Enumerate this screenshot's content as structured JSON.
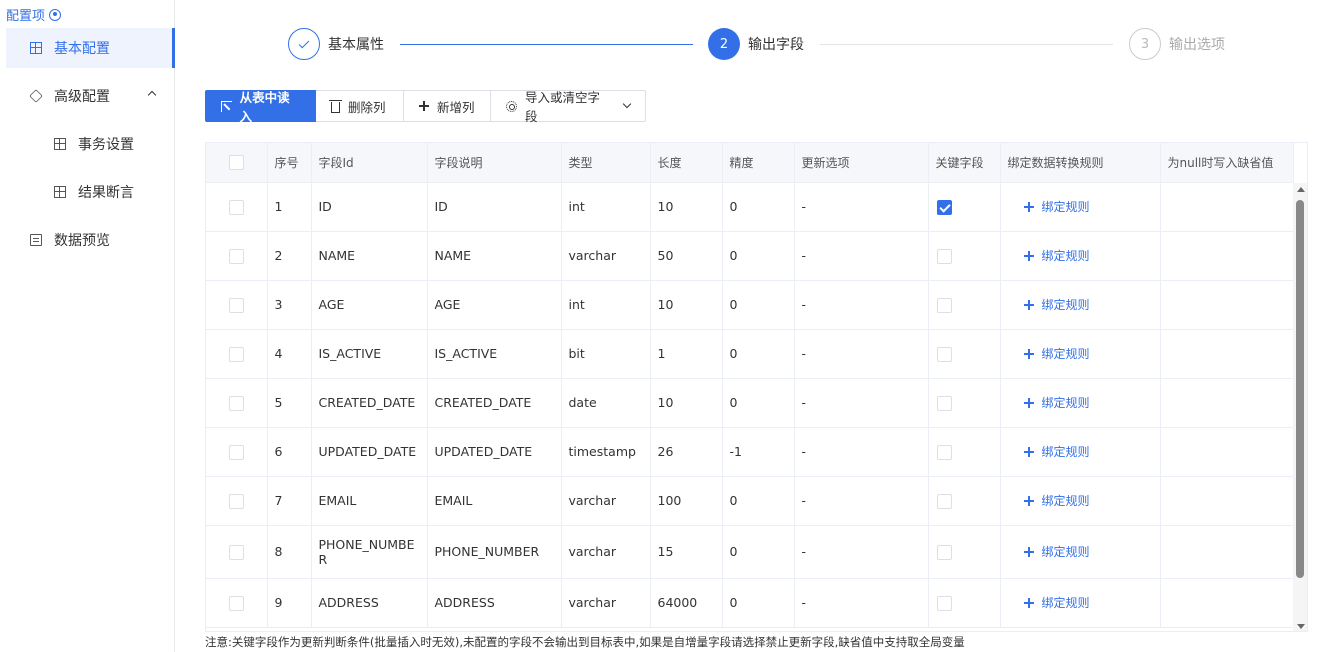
{
  "sidebar": {
    "title": "配置项",
    "items": [
      {
        "label": "基本配置"
      },
      {
        "label": "高级配置"
      },
      {
        "label": "事务设置"
      },
      {
        "label": "结果断言"
      },
      {
        "label": "数据预览"
      }
    ]
  },
  "steps": [
    {
      "label": "基本属性",
      "status": "done"
    },
    {
      "number": "2",
      "label": "输出字段",
      "status": "active"
    },
    {
      "number": "3",
      "label": "输出选项",
      "status": "wait"
    }
  ],
  "toolbar": {
    "read_from_table": "从表中读入",
    "delete_column": "删除列",
    "add_column": "新增列",
    "import_or_clear": "导入或清空字段"
  },
  "table": {
    "headers": [
      "序号",
      "字段Id",
      "字段说明",
      "类型",
      "长度",
      "精度",
      "更新选项",
      "关键字段",
      "绑定数据转换规则",
      "为null时写入缺省值"
    ],
    "bind_rule_label": "绑定规则",
    "rows": [
      {
        "no": "1",
        "id": "ID",
        "desc": "ID",
        "type": "int",
        "length": "10",
        "precision": "0",
        "update": "-",
        "key": true
      },
      {
        "no": "2",
        "id": "NAME",
        "desc": "NAME",
        "type": "varchar",
        "length": "50",
        "precision": "0",
        "update": "-",
        "key": false
      },
      {
        "no": "3",
        "id": "AGE",
        "desc": "AGE",
        "type": "int",
        "length": "10",
        "precision": "0",
        "update": "-",
        "key": false
      },
      {
        "no": "4",
        "id": "IS_ACTIVE",
        "desc": "IS_ACTIVE",
        "type": "bit",
        "length": "1",
        "precision": "0",
        "update": "-",
        "key": false
      },
      {
        "no": "5",
        "id": "CREATED_DATE",
        "desc": "CREATED_DATE",
        "type": "date",
        "length": "10",
        "precision": "0",
        "update": "-",
        "key": false
      },
      {
        "no": "6",
        "id": "UPDATED_DATE",
        "desc": "UPDATED_DATE",
        "type": "timestamp",
        "length": "26",
        "precision": "-1",
        "update": "-",
        "key": false
      },
      {
        "no": "7",
        "id": "EMAIL",
        "desc": "EMAIL",
        "type": "varchar",
        "length": "100",
        "precision": "0",
        "update": "-",
        "key": false
      },
      {
        "no": "8",
        "id": "PHONE_NUMBE\nR",
        "desc": "PHONE_NUMBER",
        "type": "varchar",
        "length": "15",
        "precision": "0",
        "update": "-",
        "key": false
      },
      {
        "no": "9",
        "id": "ADDRESS",
        "desc": "ADDRESS",
        "type": "varchar",
        "length": "64000",
        "precision": "0",
        "update": "-",
        "key": false
      }
    ]
  },
  "note": "注意:关键字段作为更新判断条件(批量插入时无效),未配置的字段不会输出到目标表中,如果是自增量字段请选择禁止更新字段,缺省值中支持取全局变量",
  "colors": {
    "accent": "#3370e8"
  }
}
